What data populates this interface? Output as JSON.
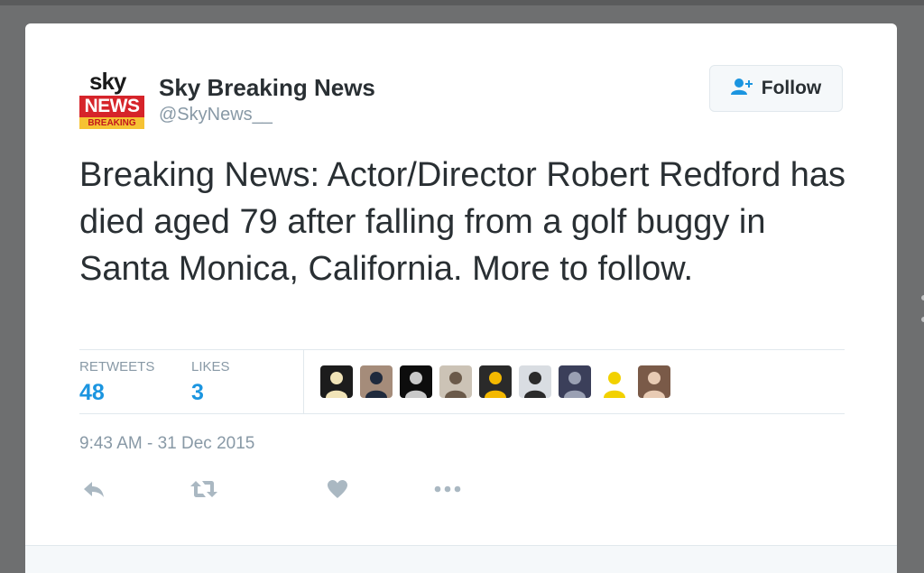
{
  "account": {
    "logo": {
      "line1": "sky",
      "line2": "NEWS",
      "line3": "BREAKING"
    },
    "name": "Sky Breaking News",
    "handle": "@SkyNews__"
  },
  "follow_button": {
    "label": "Follow",
    "icon": "add-user-icon"
  },
  "tweet": {
    "text": "Breaking News: Actor/Director Robert Redford has died aged 79 after falling from a golf buggy in Santa Monica, California. More to follow.",
    "timestamp": "9:43 AM - 31 Dec 2015"
  },
  "stats": {
    "retweets_label": "RETWEETS",
    "retweets": "48",
    "likes_label": "LIKES",
    "likes": "3"
  },
  "avatars": [
    {
      "name": "avatar-1",
      "bg": "#1c1c1c",
      "fg": "#f1e4b8"
    },
    {
      "name": "avatar-2",
      "bg": "#a58c7a",
      "fg": "#1f2a3d"
    },
    {
      "name": "avatar-3",
      "bg": "#0d0d0d",
      "fg": "#c9c9c9"
    },
    {
      "name": "avatar-4",
      "bg": "#ccc3b6",
      "fg": "#6b5a4a"
    },
    {
      "name": "avatar-5",
      "bg": "#2a2a2a",
      "fg": "#f3b800"
    },
    {
      "name": "avatar-6",
      "bg": "#d9dde2",
      "fg": "#2b2b2b"
    },
    {
      "name": "avatar-7",
      "bg": "#3b3f5a",
      "fg": "#9aa0b3"
    },
    {
      "name": "avatar-8",
      "bg": "#ffffff",
      "fg": "#f2d100"
    },
    {
      "name": "avatar-9",
      "bg": "#7a5a48",
      "fg": "#e8cbb4"
    }
  ],
  "actions": [
    {
      "name": "reply-icon"
    },
    {
      "name": "retweet-icon"
    },
    {
      "name": "like-icon"
    },
    {
      "name": "more-icon"
    }
  ],
  "colors": {
    "accent": "#1b95e0",
    "text": "#292f33",
    "muted": "#8899a6",
    "icon": "#aab8c2"
  }
}
